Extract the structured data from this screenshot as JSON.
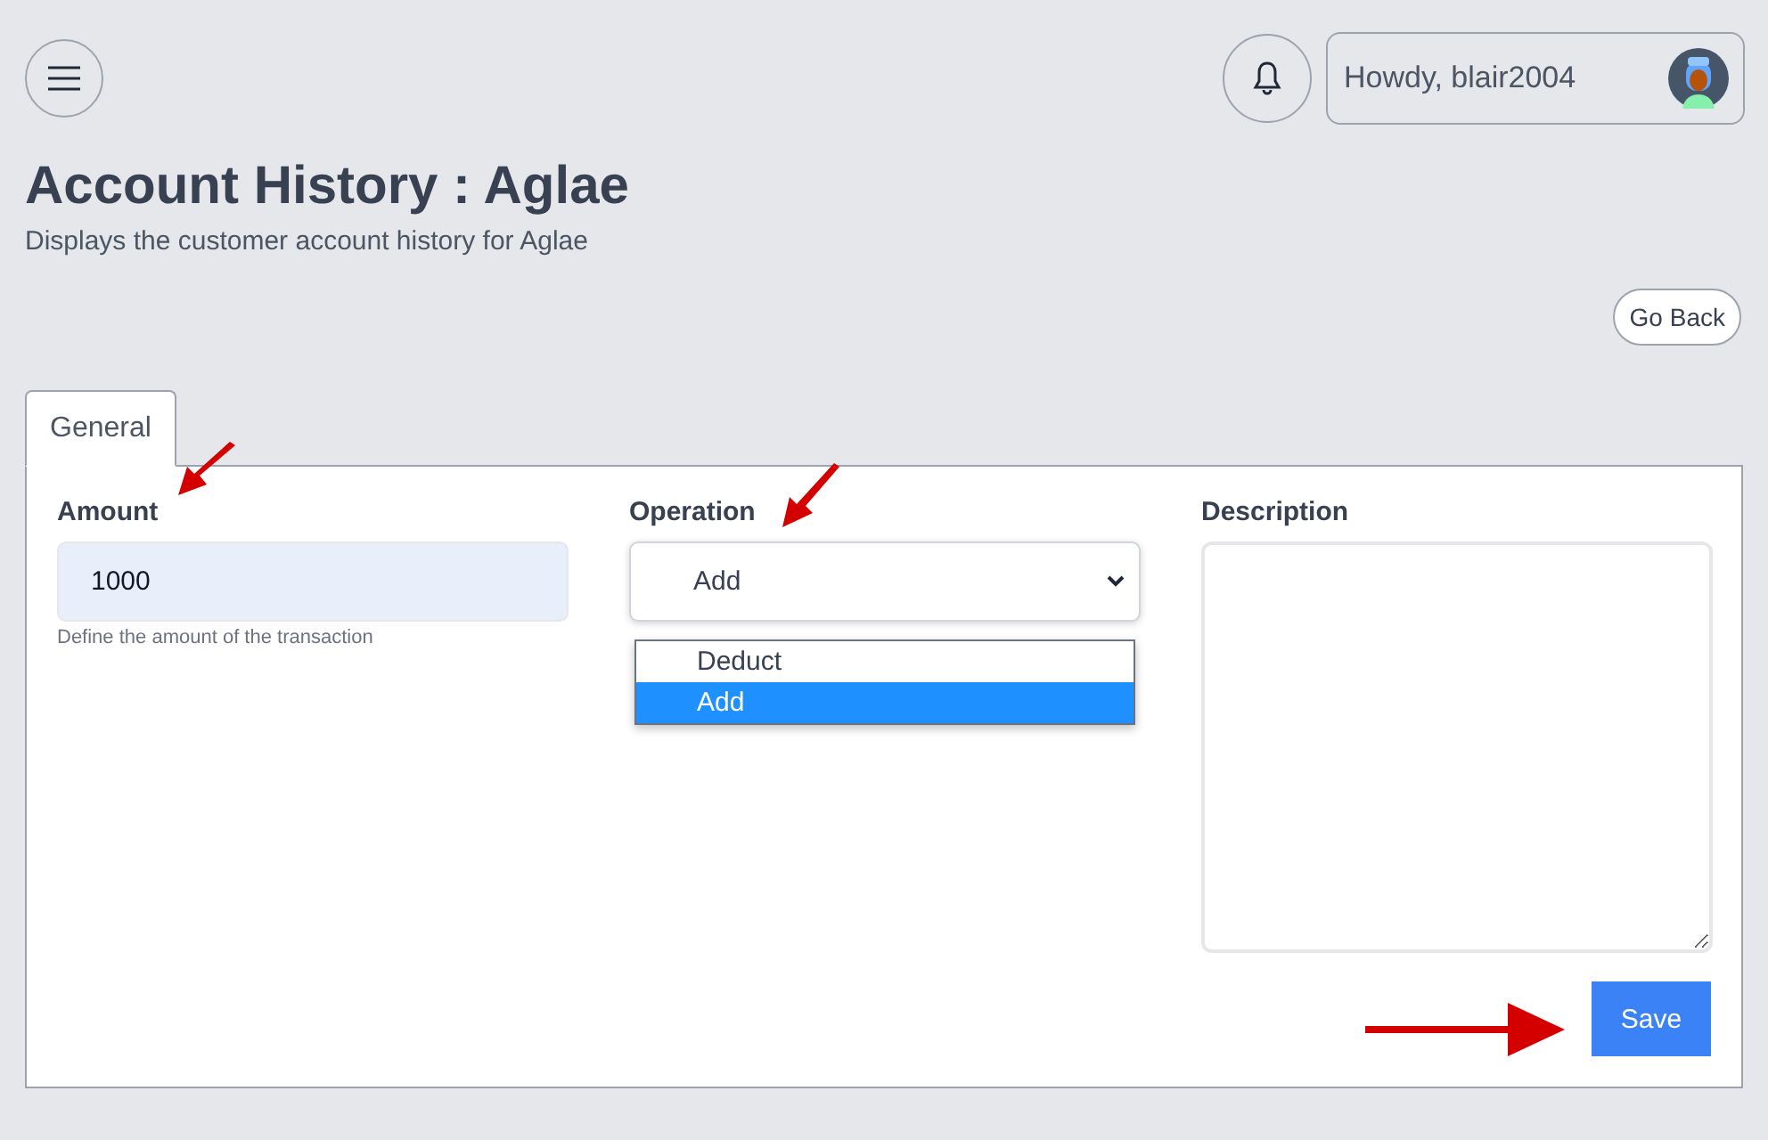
{
  "header": {
    "greeting": "Howdy, blair2004"
  },
  "page": {
    "title": "Account History : Aglae",
    "subtitle": "Displays the customer account history for Aglae",
    "back_button": "Go Back"
  },
  "tabs": [
    {
      "label": "General",
      "selected": true
    }
  ],
  "form": {
    "amount": {
      "label": "Amount",
      "value": "1000",
      "help": "Define the amount of the transaction"
    },
    "operation": {
      "label": "Operation",
      "value": "Add",
      "expanded": true,
      "options": [
        {
          "label": "Deduct",
          "selected": false
        },
        {
          "label": "Add",
          "selected": true
        }
      ]
    },
    "description": {
      "label": "Description"
    },
    "save_button": "Save"
  }
}
